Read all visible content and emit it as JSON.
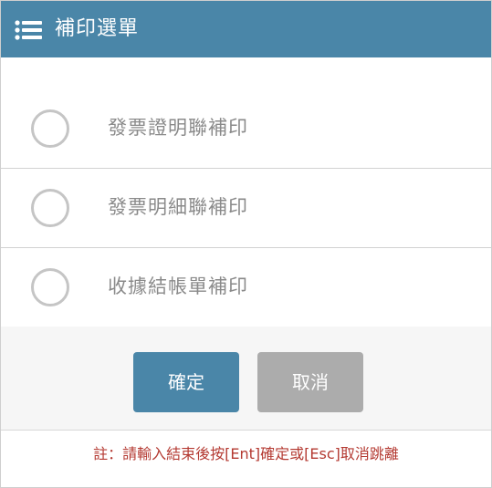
{
  "header": {
    "title": "補印選單",
    "icon": "list-icon",
    "background": "#4a86a8"
  },
  "options": [
    {
      "label": "發票證明聯補印",
      "selected": false
    },
    {
      "label": "發票明細聯補印",
      "selected": false
    },
    {
      "label": "收據結帳單補印",
      "selected": false
    }
  ],
  "buttons": {
    "confirm_label": "確定",
    "cancel_label": "取消",
    "confirm_color": "#4a86a8",
    "cancel_color": "#acacac"
  },
  "note": "註：請輸入結束後按[Ent]確定或[Esc]取消跳離",
  "note_color": "#b43a32"
}
